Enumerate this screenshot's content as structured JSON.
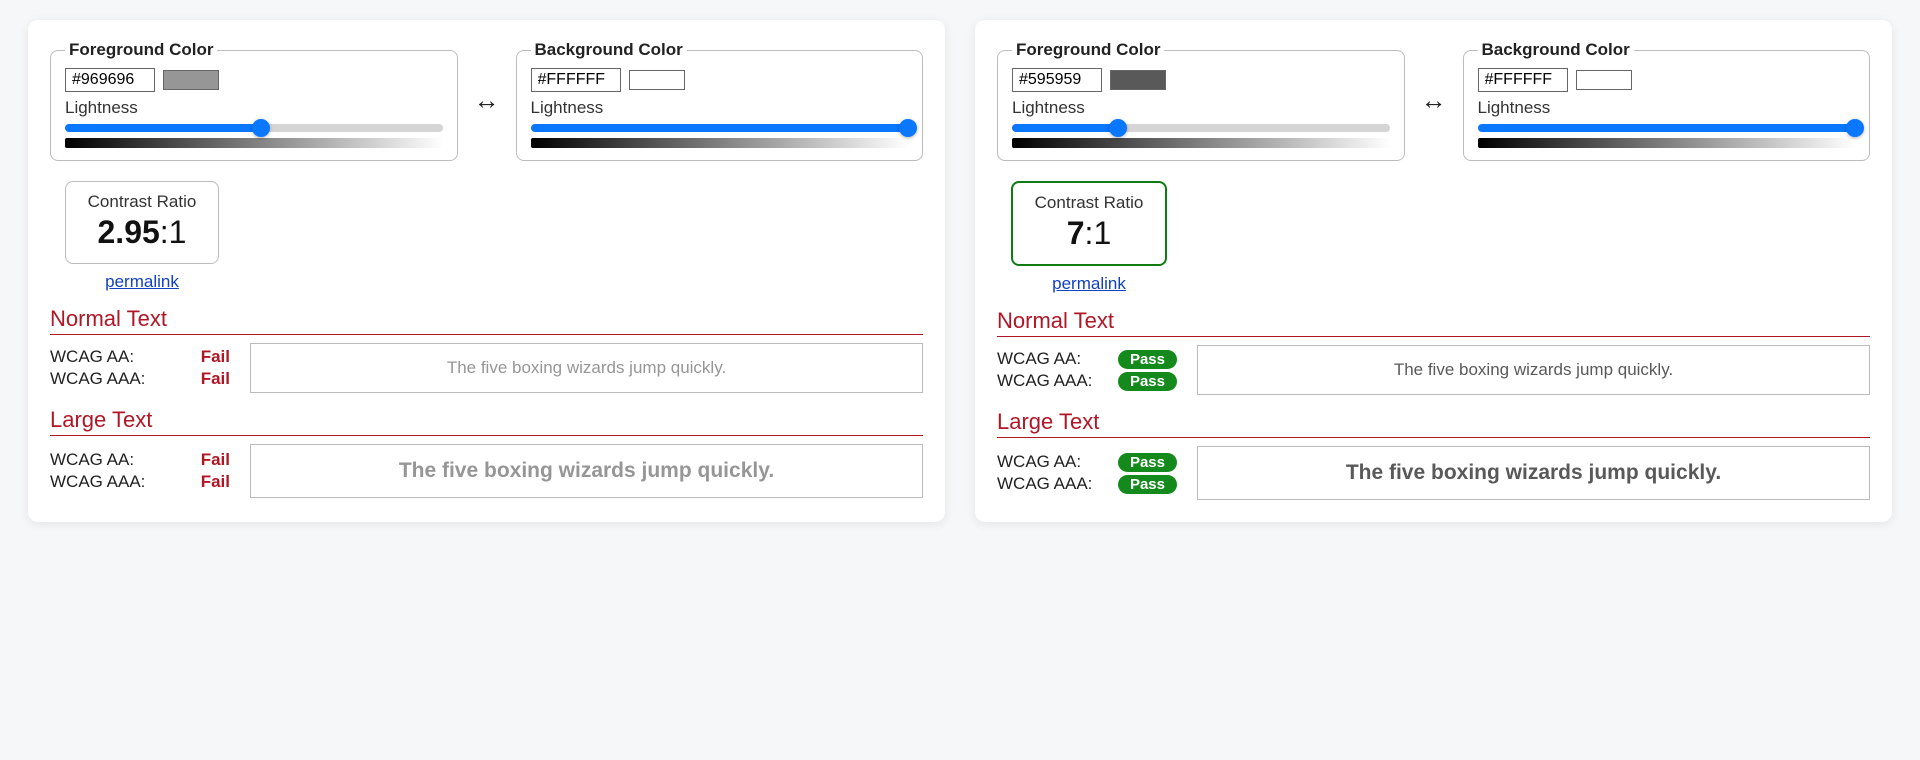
{
  "labels": {
    "foreground_legend": "Foreground Color",
    "background_legend": "Background Color",
    "lightness": "Lightness",
    "contrast_ratio": "Contrast Ratio",
    "permalink": "permalink",
    "normal_text": "Normal Text",
    "large_text": "Large Text",
    "wcag_aa": "WCAG AA:",
    "wcag_aaa": "WCAG AAA:",
    "sample_sentence": "The five boxing wizards jump quickly.",
    "fail": "Fail",
    "pass": "Pass"
  },
  "left": {
    "fg_hex": "#969696",
    "bg_hex": "#FFFFFF",
    "fg_slider_pct": 52,
    "bg_slider_pct": 100,
    "contrast_num": "2.95",
    "contrast_suffix": ":1",
    "ratio_border_pass": false,
    "fg_swatch": "#969696",
    "bg_swatch": "#FFFFFF",
    "normal": {
      "aa": "fail",
      "aaa": "fail"
    },
    "large": {
      "aa": "fail",
      "aaa": "fail"
    }
  },
  "right": {
    "fg_hex": "#595959",
    "bg_hex": "#FFFFFF",
    "fg_slider_pct": 28,
    "bg_slider_pct": 100,
    "contrast_num": "7",
    "contrast_suffix": ":1",
    "ratio_border_pass": true,
    "fg_swatch": "#595959",
    "bg_swatch": "#FFFFFF",
    "normal": {
      "aa": "pass",
      "aaa": "pass"
    },
    "large": {
      "aa": "pass",
      "aaa": "pass"
    }
  }
}
